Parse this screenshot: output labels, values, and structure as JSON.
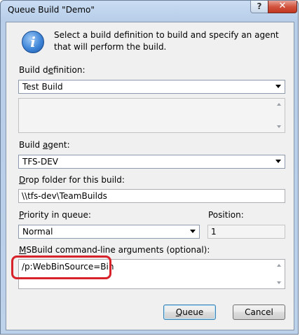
{
  "window": {
    "title": "Queue Build \"Demo\"",
    "help_label": "?",
    "close_label": "✕"
  },
  "info": {
    "icon": "info-icon",
    "icon_glyph": "i",
    "message": "Select a build definition to build and specify an agent that will perform the build."
  },
  "build_definition": {
    "label_pre": "Build d",
    "label_key": "e",
    "label_post": "finition:",
    "value": "Test Build"
  },
  "build_agent": {
    "label_pre": "Build ",
    "label_key": "a",
    "label_post": "gent:",
    "value": "TFS-DEV"
  },
  "drop_folder": {
    "label_pre": "",
    "label_key": "D",
    "label_post": "rop folder for this build:",
    "value": "\\\\tfs-dev\\TeamBuilds"
  },
  "priority": {
    "label_pre": "",
    "label_key": "P",
    "label_post": "riority in queue:",
    "value": "Normal"
  },
  "position": {
    "label": "Position:",
    "value": "1"
  },
  "msbuild": {
    "label_pre": "",
    "label_key": "M",
    "label_post": "SBuild command-line arguments (optional):",
    "value": "/p:WebBinSource=Bin",
    "highlight_color": "#d8222a"
  },
  "buttons": {
    "queue_pre": "",
    "queue_key": "Q",
    "queue_post": "ueue",
    "cancel": "Cancel"
  }
}
